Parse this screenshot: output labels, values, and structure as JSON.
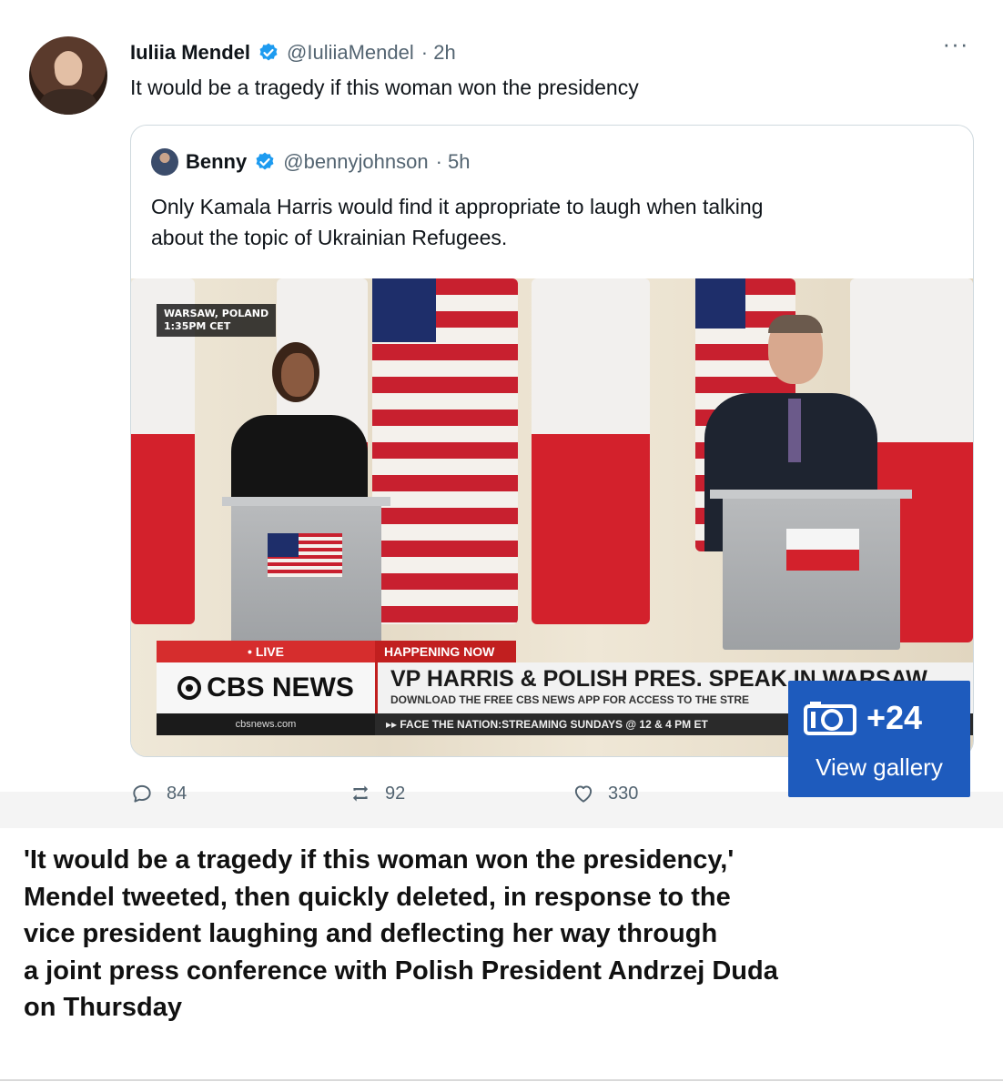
{
  "tweet": {
    "author_name": "Iuliia Mendel",
    "handle": "@IuliiaMendel",
    "time": "· 2h",
    "text": "It would be a tragedy if this woman won the presidency",
    "more_label": "···"
  },
  "quote": {
    "author_name": "Benny",
    "handle": "@bennyjohnson",
    "time": "· 5h",
    "text_lines": [
      "Only Kamala Harris would find it appropriate to laugh when talking",
      "about the topic of Ukrainian Refugees."
    ]
  },
  "video": {
    "location_lines": [
      "WARSAW, POLAND",
      "1:35PM CET"
    ],
    "live_label": "• LIVE",
    "happening_label": "HAPPENING NOW",
    "network_name": "CBS NEWS",
    "headline": "VP HARRIS & POLISH PRES. SPEAK IN WARSAW",
    "subheadline": "DOWNLOAD THE FREE CBS NEWS APP FOR ACCESS TO THE STRE",
    "site": "cbsnews.com",
    "ticker": "▸▸ FACE THE NATION:STREAMING SUNDAYS @ 12 & 4 PM ET"
  },
  "gallery": {
    "count": "+24",
    "label": "View gallery",
    "color": "#1e5bbd"
  },
  "actions": {
    "replies": "84",
    "retweets": "92",
    "likes": "330"
  },
  "caption_lines": [
    "'It would be a tragedy if this woman won the presidency,'",
    "Mendel tweeted, then quickly deleted, in response to the",
    "vice president laughing and deflecting her way through",
    "a joint press conference with Polish President Andrzej Duda",
    "on Thursday"
  ],
  "colors": {
    "verified": "#1d9bf0",
    "secondary_text": "#536471",
    "cbs_red": "#c11f1f"
  }
}
